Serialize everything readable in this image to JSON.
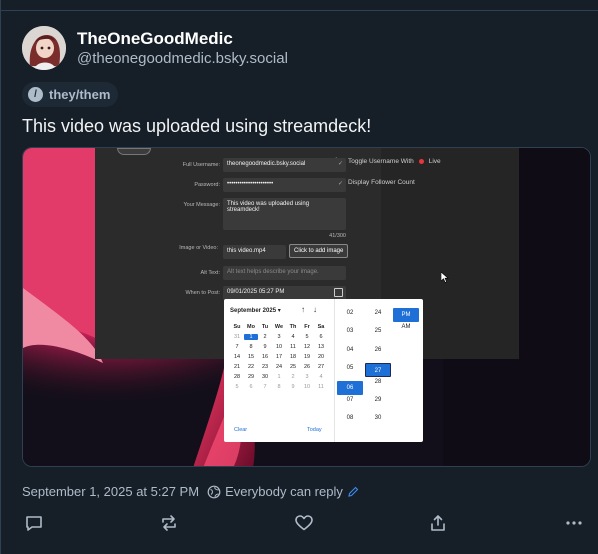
{
  "post": {
    "display_name": "TheOneGoodMedic",
    "handle": "@theonegoodmedic.bsky.social",
    "pronouns": "they/them",
    "text": "This video was uploaded using streamdeck!",
    "timestamp": "September 1, 2025 at 5:27 PM",
    "reply_setting": "Everybody can reply"
  },
  "video": {
    "fields": [
      {
        "label": "Full Username:",
        "value": "theonegoodmedic.bsky.social"
      },
      {
        "label": "Password:",
        "value": "••••••••••••••••••••••"
      },
      {
        "label": "Your Message:",
        "value": "This video was uploaded using streamdeck!"
      },
      {
        "label": "Image or Video:",
        "value": "this video.mp4"
      },
      {
        "label": "Alt Text:",
        "value": "Alt text helps describe your image."
      },
      {
        "label": "When to Post:",
        "value": "09/01/2025 05:27 PM"
      }
    ],
    "char_count": "41/300",
    "add_image_button": "Click to add image",
    "side_toggle": "Toggle Username With",
    "side_live": "Live",
    "side_follower": "Display Follower Count",
    "calendar": {
      "month": "September 2025",
      "weekdays": [
        "Su",
        "Mo",
        "Tu",
        "We",
        "Th",
        "Fr",
        "Sa"
      ],
      "weeks": [
        [
          "31",
          "1",
          "2",
          "3",
          "4",
          "5",
          "6"
        ],
        [
          "7",
          "8",
          "9",
          "10",
          "11",
          "12",
          "13"
        ],
        [
          "14",
          "15",
          "16",
          "17",
          "18",
          "19",
          "20"
        ],
        [
          "21",
          "22",
          "23",
          "24",
          "25",
          "26",
          "27"
        ],
        [
          "28",
          "29",
          "30",
          "1",
          "2",
          "3",
          "4"
        ],
        [
          "5",
          "6",
          "7",
          "8",
          "9",
          "10",
          "11"
        ]
      ],
      "clear": "Clear",
      "today": "Today",
      "hours": [
        "02",
        "03",
        "04",
        "05",
        "06",
        "07",
        "08"
      ],
      "minutes": [
        "24",
        "25",
        "26",
        "27",
        "28",
        "29",
        "30"
      ],
      "ampm": [
        "PM",
        "AM"
      ],
      "selected_hour": "05",
      "selected_minute": "27"
    }
  },
  "colors": {
    "background": "#161e27",
    "text_muted": "#aebbc9",
    "accent": "#1e6fd6"
  }
}
